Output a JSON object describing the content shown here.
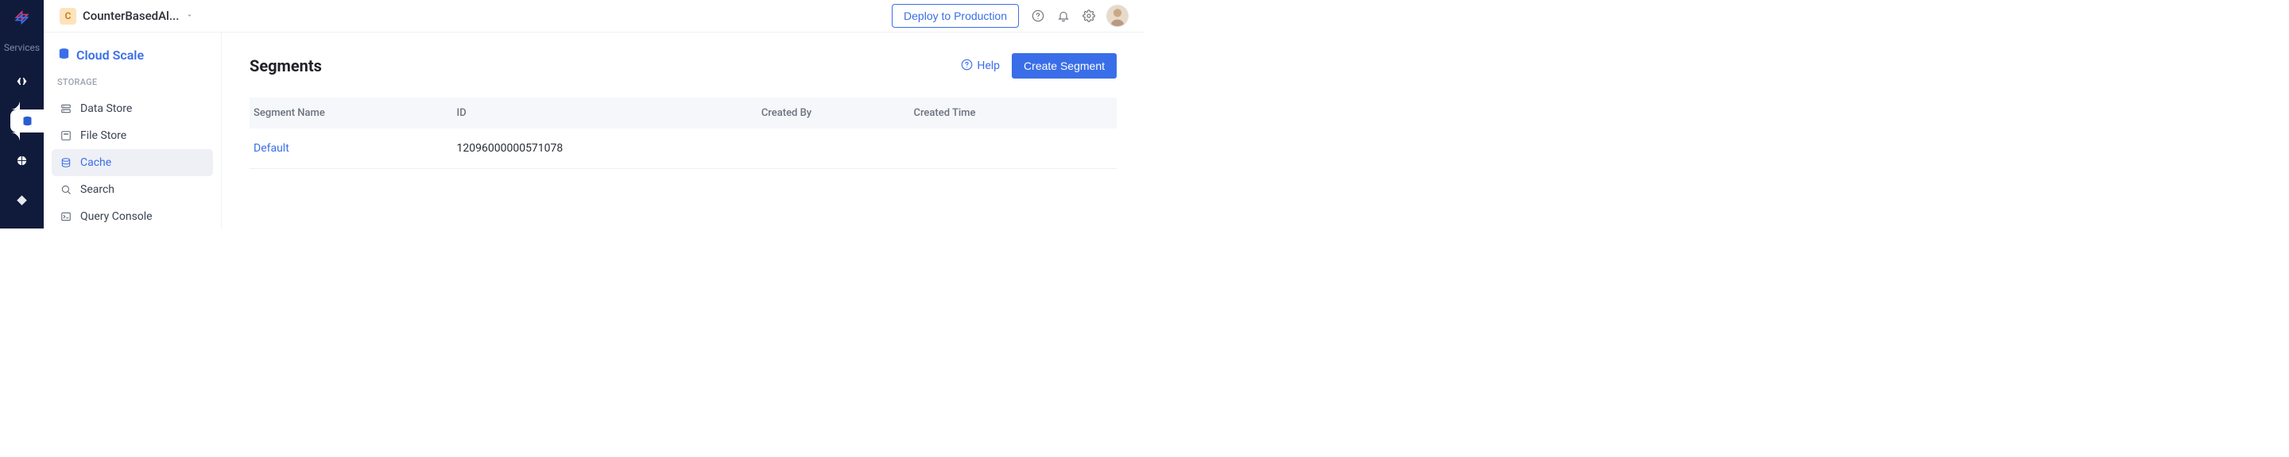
{
  "app": {
    "badge": "C",
    "name": "CounterBasedAl..."
  },
  "top": {
    "deploy": "Deploy to Production",
    "rail_label": "Services"
  },
  "side": {
    "section_title": "Cloud Scale",
    "subheading": "STORAGE",
    "items": [
      {
        "label": "Data Store"
      },
      {
        "label": "File Store"
      },
      {
        "label": "Cache"
      },
      {
        "label": "Search"
      },
      {
        "label": "Query Console"
      }
    ]
  },
  "page": {
    "title": "Segments",
    "help_label": "Help",
    "create_label": "Create Segment"
  },
  "table": {
    "headers": {
      "c0": "Segment Name",
      "c1": "ID",
      "c2": "Created By",
      "c3": "Created Time"
    },
    "rows": [
      {
        "name": "Default",
        "id": "12096000000571078",
        "by": "",
        "time": ""
      }
    ]
  }
}
